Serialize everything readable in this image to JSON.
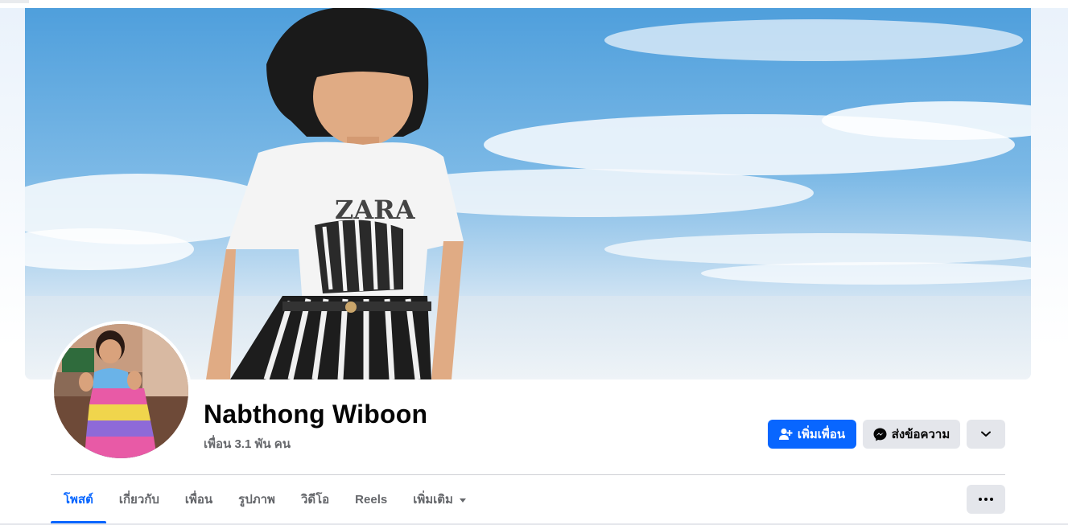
{
  "profile": {
    "name": "Nabthong Wiboon",
    "friends_text": "เพื่อน 3.1 พัน คน"
  },
  "actions": {
    "add_friend_label": "เพิ่มเพื่อน",
    "message_label": "ส่งข้อความ",
    "more_icon": "chevron-down-icon"
  },
  "cover": {
    "shirt_text": "ZARA"
  },
  "tabs": [
    {
      "label": "โพสต์",
      "active": true
    },
    {
      "label": "เกี่ยวกับ",
      "active": false
    },
    {
      "label": "เพื่อน",
      "active": false
    },
    {
      "label": "รูปภาพ",
      "active": false
    },
    {
      "label": "วิดีโอ",
      "active": false
    },
    {
      "label": "Reels",
      "active": false
    },
    {
      "label": "เพิ่มเติม",
      "active": false
    }
  ],
  "colors": {
    "accent": "#0866ff",
    "secondary_button": "#e4e6eb",
    "muted_text": "#65676b"
  }
}
